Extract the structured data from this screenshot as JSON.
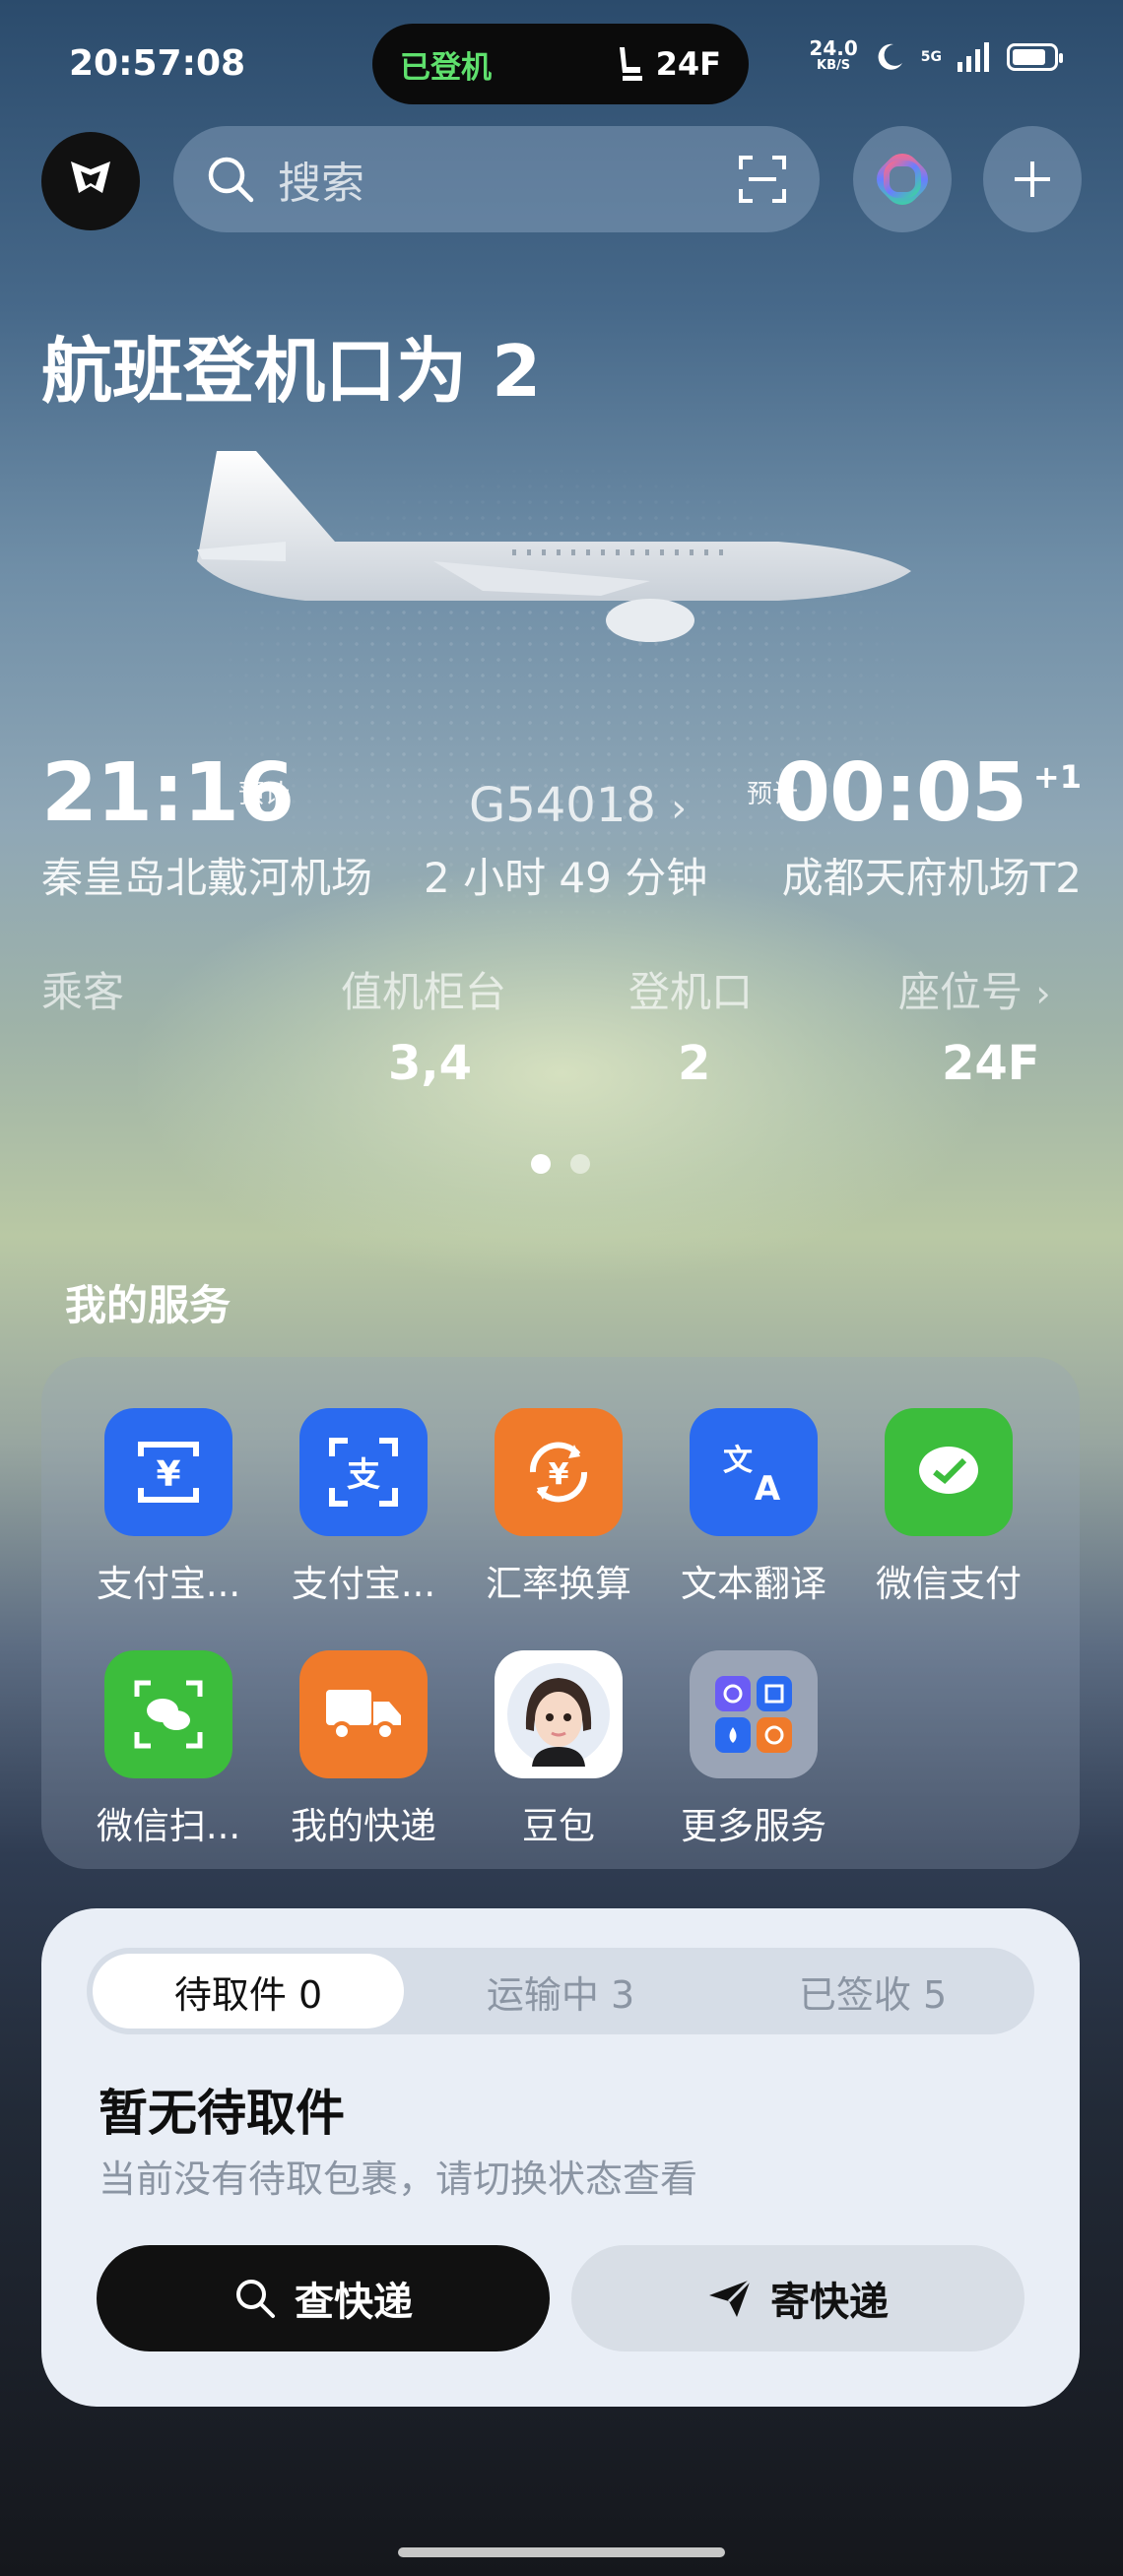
{
  "status_bar": {
    "time": "20:57:08",
    "island_status": "已登机",
    "island_seat": "24F",
    "net_speed": "24.0",
    "net_speed_unit": "KB/S",
    "network": "5G",
    "battery_level": 0.82
  },
  "top_bar": {
    "search_placeholder": "搜索"
  },
  "flight": {
    "title": "航班登机口为 2",
    "departure_time": "21:16",
    "departure_tag": "预计",
    "arrival_time": "00:05",
    "arrival_tag": "预计",
    "arrival_day_offset": "+1",
    "flight_number": "G54018",
    "duration": "2 小时 49 分钟",
    "departure_airport": "秦皇岛北戴河机场",
    "arrival_airport": "成都天府机场T2",
    "info_headers": [
      "乘客",
      "值机柜台",
      "登机口",
      "座位号"
    ],
    "checkin_counter": "3,4",
    "gate": "2",
    "seat": "24F"
  },
  "services": {
    "title": "我的服务",
    "items": [
      {
        "label": "支付宝...",
        "icon": "alipay-pay-icon",
        "color": "#2a6af0"
      },
      {
        "label": "支付宝...",
        "icon": "alipay-scan-icon",
        "color": "#2a6af0"
      },
      {
        "label": "汇率换算",
        "icon": "currency-exchange-icon",
        "color": "#f07a2a"
      },
      {
        "label": "文本翻译",
        "icon": "translate-icon",
        "color": "#2a6af0"
      },
      {
        "label": "微信支付",
        "icon": "wechat-pay-icon",
        "color": "#3cbd3c"
      },
      {
        "label": "微信扫...",
        "icon": "wechat-scan-icon",
        "color": "#3cbd3c"
      },
      {
        "label": "我的快递",
        "icon": "delivery-truck-icon",
        "color": "#f07a2a"
      },
      {
        "label": "豆包",
        "icon": "doubao-avatar-icon",
        "color": "#ffffff"
      },
      {
        "label": "更多服务",
        "icon": "more-services-icon",
        "color": "#9aa4b6"
      }
    ]
  },
  "express": {
    "tabs": [
      "待取件 0",
      "运输中 3",
      "已签收 5"
    ],
    "active_tab": 0,
    "heading": "暂无待取件",
    "subtitle": "当前没有待取包裹，请切换状态查看",
    "query_button": "查快递",
    "send_button": "寄快递"
  }
}
